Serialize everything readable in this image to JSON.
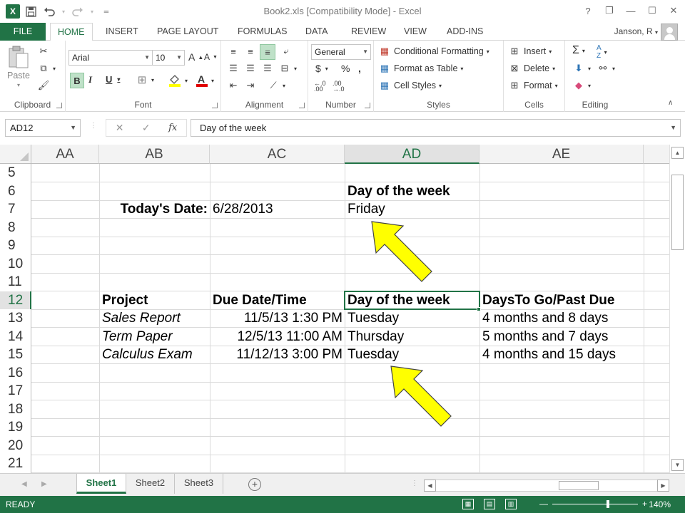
{
  "window": {
    "title": "Book2.xls  [Compatibility Mode] - Excel",
    "controls": [
      "?",
      "❐",
      "—",
      "☐",
      "✕"
    ]
  },
  "qat": {
    "logo": "X",
    "save_icon": "save-icon",
    "undo_icon": "undo-icon",
    "redo_icon": "redo-icon",
    "customize_icon": "customize-icon"
  },
  "tabs": [
    {
      "label": "FILE"
    },
    {
      "label": "HOME"
    },
    {
      "label": "INSERT"
    },
    {
      "label": "PAGE LAYOUT"
    },
    {
      "label": "FORMULAS"
    },
    {
      "label": "DATA"
    },
    {
      "label": "REVIEW"
    },
    {
      "label": "VIEW"
    },
    {
      "label": "ADD-INS"
    }
  ],
  "user": {
    "name": "Janson, R"
  },
  "ribbon": {
    "clipboard": {
      "label": "Clipboard",
      "paste": "Paste"
    },
    "font": {
      "label": "Font",
      "font_name": "Arial",
      "font_size": "10"
    },
    "alignment": {
      "label": "Alignment"
    },
    "number": {
      "label": "Number",
      "format": "General"
    },
    "styles": {
      "label": "Styles",
      "conditional": "Conditional Formatting",
      "format_table": "Format as Table",
      "cell_styles": "Cell Styles"
    },
    "cells": {
      "label": "Cells",
      "insert": "Insert",
      "delete": "Delete",
      "format": "Format"
    },
    "editing": {
      "label": "Editing"
    }
  },
  "formula_bar": {
    "name_box": "AD12",
    "formula": "Day of the week",
    "fx": "fx"
  },
  "columns": [
    "AA",
    "AB",
    "AC",
    "AD",
    "AE"
  ],
  "rows": [
    "5",
    "6",
    "7",
    "8",
    "9",
    "10",
    "11",
    "12",
    "13",
    "14",
    "15",
    "16",
    "17",
    "18",
    "19",
    "20",
    "21"
  ],
  "cells": {
    "ad6": "Day of the week",
    "ab7": "Today's Date:",
    "ac7": "6/28/2013",
    "ad7": "Friday",
    "ab12": "Project",
    "ac12": "Due Date/Time",
    "ad12": "Day of the week",
    "ae12": "DaysTo Go/Past Due",
    "ab13": "Sales Report",
    "ac13": "11/5/13 1:30 PM",
    "ad13": "Tuesday",
    "ae13": "4 months and 8 days",
    "ab14": "Term Paper",
    "ac14": "12/5/13 11:00 AM",
    "ad14": "Thursday",
    "ae14": "5 months and 7 days",
    "ab15": "Calculus Exam",
    "ac15": "11/12/13 3:00 PM",
    "ad15": "Tuesday",
    "ae15": "4 months and 15 days"
  },
  "sheets": [
    {
      "label": "Sheet1",
      "active": true
    },
    {
      "label": "Sheet2",
      "active": false
    },
    {
      "label": "Sheet3",
      "active": false
    }
  ],
  "status": {
    "ready": "READY",
    "zoom": "140%"
  },
  "colors": {
    "accent": "#217346",
    "arrow_fill": "#ffff00"
  }
}
